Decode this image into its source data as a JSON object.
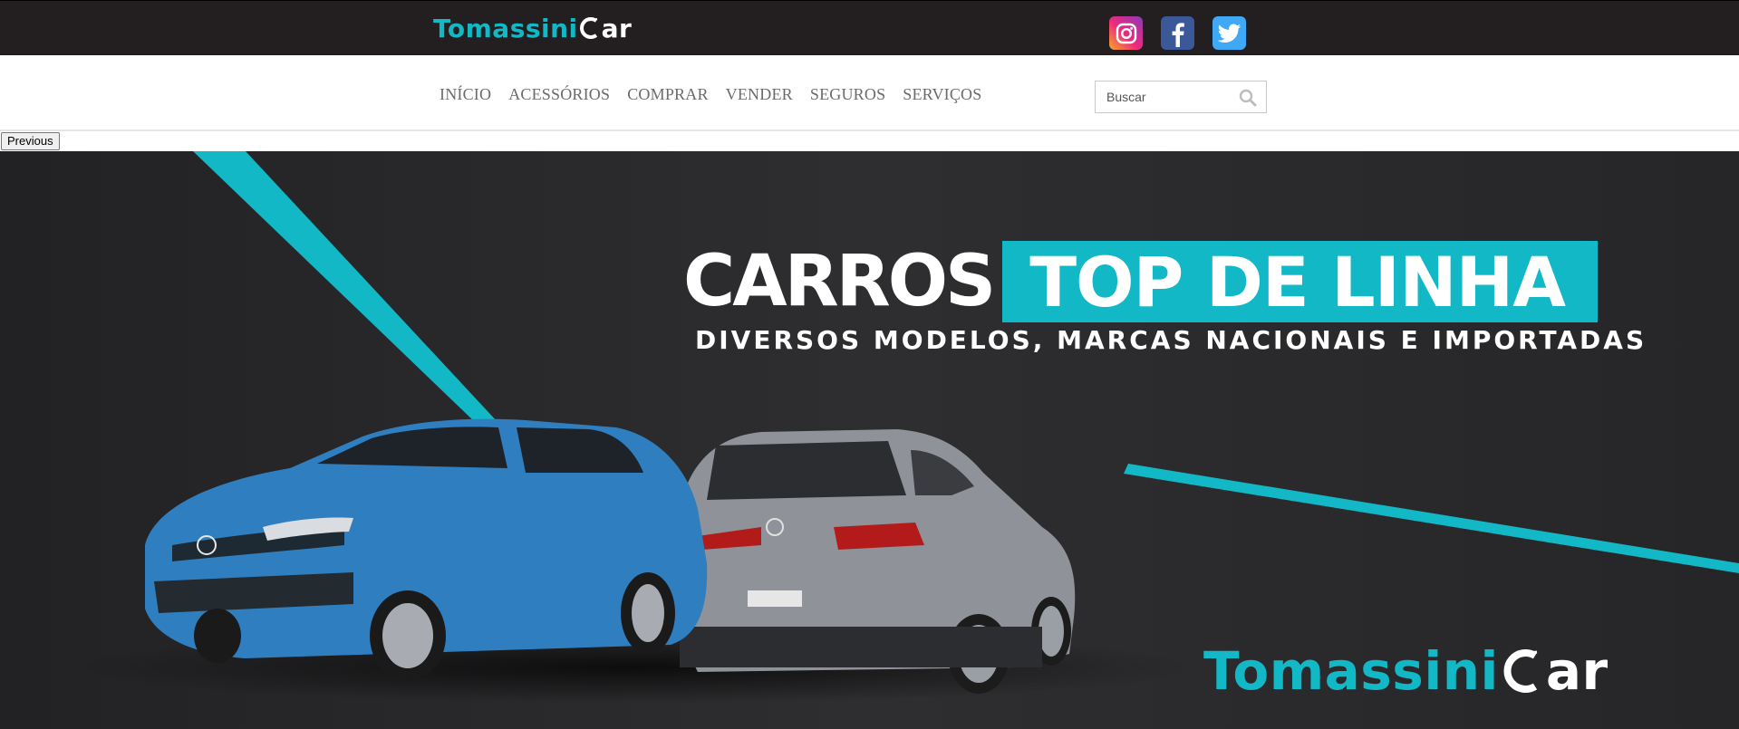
{
  "brand": {
    "name_part1": "Tomassini",
    "name_part2": "ar",
    "teal": "#12b8c6",
    "dark": "#231f20"
  },
  "social": [
    {
      "name": "instagram",
      "icon": "instagram-icon"
    },
    {
      "name": "facebook",
      "icon": "facebook-icon"
    },
    {
      "name": "twitter",
      "icon": "twitter-icon"
    }
  ],
  "nav": {
    "items": [
      "INÍCIO",
      "ACESSÓRIOS",
      "COMPRAR",
      "VENDER",
      "SEGUROS",
      "SERVIÇOS"
    ]
  },
  "search": {
    "placeholder": "Buscar",
    "icon": "search-icon"
  },
  "slider": {
    "previous_label": "Previous"
  },
  "banner": {
    "headline_white": "CARROS",
    "headline_box": "TOP DE LINHA",
    "subline": "DIVERSOS MODELOS, MARCAS NACIONAIS E IMPORTADAS",
    "logo_part1": "Tomassini",
    "logo_part2": "ar"
  }
}
